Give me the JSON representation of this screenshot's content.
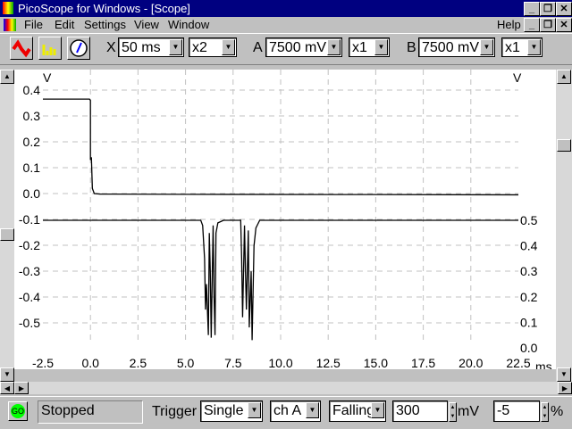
{
  "window": {
    "title": "PicoScope for Windows - [Scope]"
  },
  "menu": {
    "items": [
      "File",
      "Edit",
      "Settings",
      "View",
      "Window"
    ],
    "help": "Help"
  },
  "toolbar": {
    "x_label": "X",
    "timebase": "50 ms",
    "x_mult": "x2",
    "a_label": "A",
    "a_range": "7500 mV",
    "a_mult": "x1",
    "b_label": "B",
    "b_range": "7500 mV",
    "b_mult": "x1"
  },
  "status": {
    "go": "GO",
    "state": "Stopped",
    "trigger_label": "Trigger",
    "mode": "Single",
    "channel": "ch A",
    "edge": "Falling",
    "level": "300",
    "level_unit": "mV",
    "delay": "-5",
    "delay_unit": "%"
  },
  "chart_data": {
    "type": "line",
    "xlabel": "ms",
    "ylabel_left": "V",
    "ylabel_right": "V",
    "xlim": [
      -2.5,
      22.5
    ],
    "ylim_left": [
      -0.55,
      0.4
    ],
    "ylim_right": [
      0,
      0.5
    ],
    "x_ticks": [
      "-2.5",
      "0.0",
      "2.5",
      "5.0",
      "7.5",
      "10.0",
      "12.5",
      "15.0",
      "17.5",
      "20.0",
      "22.5"
    ],
    "y_ticks_left": [
      "0.4",
      "0.3",
      "0.2",
      "0.1",
      "0.0",
      "-0.1",
      "-0.2",
      "-0.3",
      "-0.4",
      "-0.5"
    ],
    "y_ticks_right": [
      "0.5",
      "0.4",
      "0.3",
      "0.2",
      "0.1",
      "0.0"
    ],
    "grid": true,
    "series": [
      {
        "name": "A",
        "axis": "left",
        "points": [
          [
            -2.5,
            0.365
          ],
          [
            -0.05,
            0.365
          ],
          [
            0,
            0.36
          ],
          [
            0,
            0.13
          ],
          [
            0.05,
            0.14
          ],
          [
            0.1,
            0.02
          ],
          [
            0.2,
            0.0
          ],
          [
            0.5,
            -0.002
          ],
          [
            5,
            -0.003
          ],
          [
            15,
            -0.004
          ],
          [
            22.5,
            -0.005
          ]
        ]
      },
      {
        "name": "B",
        "axis": "right",
        "points": [
          [
            -2.5,
            0.5
          ],
          [
            5.8,
            0.5
          ],
          [
            5.9,
            0.48
          ],
          [
            6.0,
            0.35
          ],
          [
            6.05,
            0.15
          ],
          [
            6.1,
            0.25
          ],
          [
            6.2,
            0.05
          ],
          [
            6.25,
            0.45
          ],
          [
            6.3,
            0.3
          ],
          [
            6.35,
            0.04
          ],
          [
            6.45,
            0.48
          ],
          [
            6.5,
            0.2
          ],
          [
            6.55,
            0.05
          ],
          [
            6.6,
            0.45
          ],
          [
            6.7,
            0.49
          ],
          [
            7.0,
            0.5
          ],
          [
            7.9,
            0.5
          ],
          [
            7.95,
            0.35
          ],
          [
            8.0,
            0.12
          ],
          [
            8.1,
            0.48
          ],
          [
            8.15,
            0.3
          ],
          [
            8.2,
            0.15
          ],
          [
            8.3,
            0.46
          ],
          [
            8.35,
            0.08
          ],
          [
            8.45,
            0.3
          ],
          [
            8.5,
            0.03
          ],
          [
            8.6,
            0.4
          ],
          [
            8.7,
            0.47
          ],
          [
            8.9,
            0.5
          ],
          [
            22.5,
            0.5
          ]
        ]
      }
    ]
  }
}
